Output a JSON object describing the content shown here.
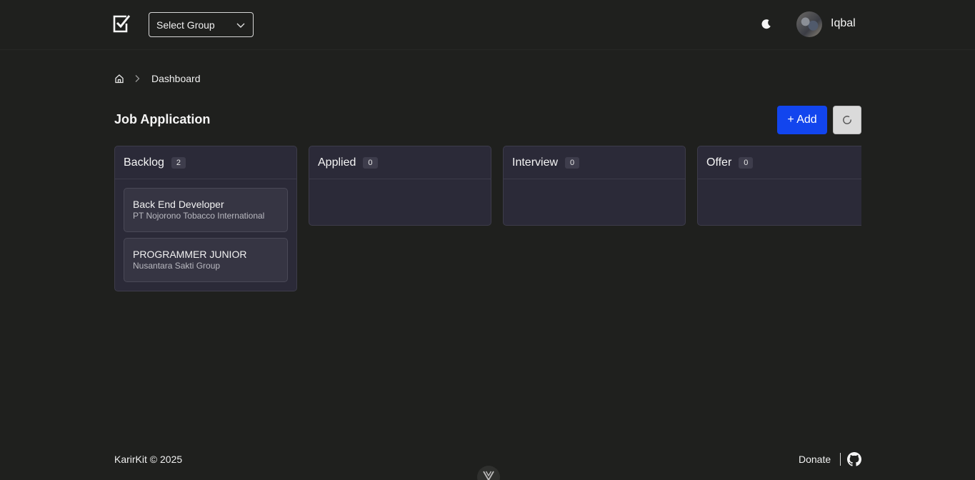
{
  "header": {
    "group_select": {
      "label": "Select Group"
    },
    "user": {
      "name": "Iqbal"
    }
  },
  "breadcrumb": {
    "current": "Dashboard"
  },
  "page": {
    "title": "Job Application",
    "add_label": "+ Add"
  },
  "board": {
    "columns": [
      {
        "title": "Backlog",
        "count": "2",
        "cards": [
          {
            "title": "Back End Developer",
            "company": "PT Nojorono Tobacco International"
          },
          {
            "title": "PROGRAMMER JUNIOR",
            "company": "Nusantara Sakti Group"
          }
        ]
      },
      {
        "title": "Applied",
        "count": "0",
        "cards": []
      },
      {
        "title": "Interview",
        "count": "0",
        "cards": []
      },
      {
        "title": "Offer",
        "count": "0",
        "cards": []
      }
    ]
  },
  "footer": {
    "brand": "KarirKit © 2025",
    "donate": "Donate"
  },
  "colors": {
    "background": "#1f201e",
    "column_bg": "#2b2a38",
    "card_bg": "#363543",
    "accent": "#1245ee"
  },
  "icons": [
    "checkbox-logo-icon",
    "chevron-down-icon",
    "moon-icon",
    "home-icon",
    "chevron-right-icon",
    "refresh-icon",
    "github-icon",
    "vue-devtools-icon"
  ]
}
